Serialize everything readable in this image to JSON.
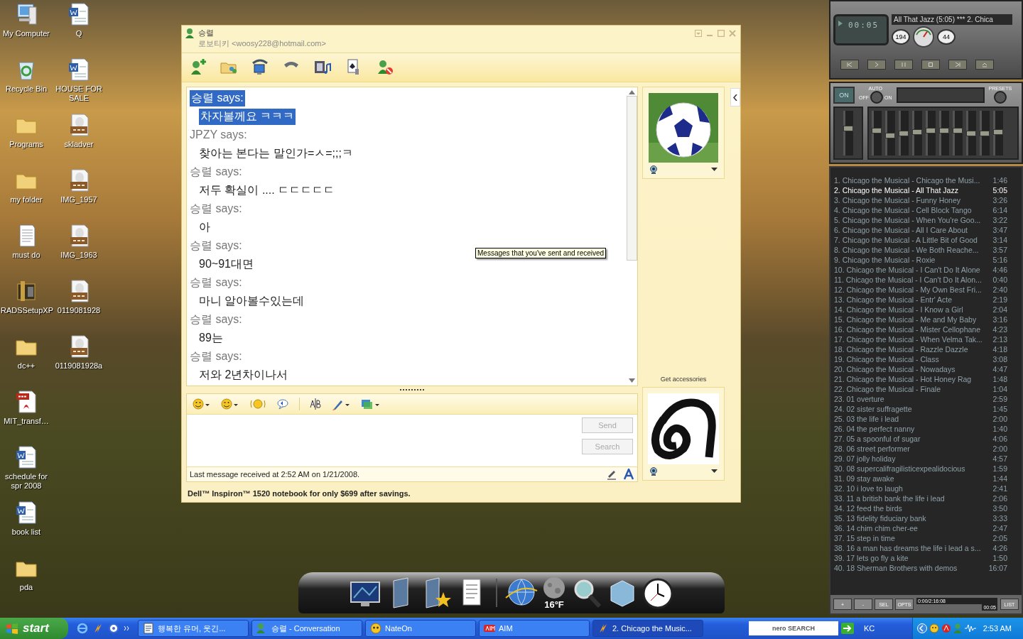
{
  "desktop_icons": [
    {
      "label": "My Computer",
      "kind": "computer"
    },
    {
      "label": "Recycle Bin",
      "kind": "recycle"
    },
    {
      "label": "Programs",
      "kind": "folder"
    },
    {
      "label": "my folder",
      "kind": "folder"
    },
    {
      "label": "must do",
      "kind": "text"
    },
    {
      "label": "RADSSetupXP",
      "kind": "installer"
    },
    {
      "label": "dc++",
      "kind": "folder"
    },
    {
      "label": "MIT_transf…",
      "kind": "pdf"
    },
    {
      "label": "schedule for spr 2008",
      "kind": "word"
    },
    {
      "label": "book list",
      "kind": "word"
    },
    {
      "label": "pda",
      "kind": "folder"
    },
    {
      "label": "Q",
      "kind": "word"
    },
    {
      "label": "HOUSE FOR SALE",
      "kind": "word"
    },
    {
      "label": "skladver",
      "kind": "jpg"
    },
    {
      "label": "IMG_1957",
      "kind": "jpg"
    },
    {
      "label": "IMG_1963",
      "kind": "jpg"
    },
    {
      "label": "0119081928",
      "kind": "jpg"
    },
    {
      "label": "0119081928a",
      "kind": "jpg"
    }
  ],
  "messenger": {
    "title": "승렬",
    "subtitle": "로보티키 <woosy228@hotmail.com>",
    "messages": [
      {
        "sender": "승렬 says:",
        "text": "차자볼께요 ㅋㅋㅋ",
        "selected": true
      },
      {
        "sender": "JPZY says:",
        "text": "찾아는 본다는 말인가=ㅅ=;;;ㅋ",
        "selected": false
      },
      {
        "sender": "승렬 says:",
        "text": "저두 확실이 .... ㄷㄷㄷㄷㄷ",
        "selected": false
      },
      {
        "sender": "승렬 says:",
        "text": "아",
        "selected": false
      },
      {
        "sender": "승렬 says:",
        "text": "90~91대면",
        "selected": false
      },
      {
        "sender": "승렬 says:",
        "text": "마니 알아볼수있는데",
        "selected": false
      },
      {
        "sender": "승렬 says:",
        "text": "89는",
        "selected": false
      },
      {
        "sender": "승렬 says:",
        "text": "저와 2년차이나서",
        "selected": false
      }
    ],
    "tooltip": "Messages that you've sent and received",
    "accessories_link": "Get accessories",
    "buttons": [
      {
        "label": "Send",
        "disabled": true
      },
      {
        "label": "Search",
        "disabled": true
      }
    ],
    "status": "Last message received at 2:52 AM on 1/21/2008.",
    "ad": "Dell™ Inspiron™ 1520 notebook for only $699 after savings."
  },
  "winamp": {
    "time": "00:05",
    "marquee": "All That Jazz (5:05) *** 2. Chica",
    "kbps": "194",
    "khz": "44",
    "preamp": {
      "level": 0.6
    },
    "bands": [
      {
        "level": 0.55
      },
      {
        "level": 0.45
      },
      {
        "level": 0.5
      },
      {
        "level": 0.52
      },
      {
        "level": 0.55
      },
      {
        "level": 0.55
      },
      {
        "level": 0.55
      },
      {
        "level": 0.5
      },
      {
        "level": 0.5
      },
      {
        "level": 0.52
      }
    ],
    "eq_labels": {
      "power": "ON",
      "auto": "AUTO",
      "off": "OFF",
      "on": "ON",
      "presets": "PRESETS"
    },
    "tracks": [
      {
        "title": "1. Chicago the Musical - Chicago the Musi...",
        "duration": "1:46",
        "selected": false
      },
      {
        "title": "2. Chicago the Musical - All That Jazz",
        "duration": "5:05",
        "selected": true
      },
      {
        "title": "3. Chicago the Musical - Funny Honey",
        "duration": "3:26",
        "selected": false
      },
      {
        "title": "4. Chicago the Musical - Cell Block Tango",
        "duration": "6:14",
        "selected": false
      },
      {
        "title": "5. Chicago the Musical - When You're Goo...",
        "duration": "3:22",
        "selected": false
      },
      {
        "title": "6. Chicago the Musical - All I Care About",
        "duration": "3:47",
        "selected": false
      },
      {
        "title": "7. Chicago the Musical - A Little Bit of Good",
        "duration": "3:14",
        "selected": false
      },
      {
        "title": "8. Chicago the Musical - We Both Reache...",
        "duration": "3:57",
        "selected": false
      },
      {
        "title": "9. Chicago the Musical - Roxie",
        "duration": "5:16",
        "selected": false
      },
      {
        "title": "10. Chicago the Musical - I Can't Do It Alone",
        "duration": "4:46",
        "selected": false
      },
      {
        "title": "11. Chicago the Musical - I Can't Do It Alon...",
        "duration": "0:40",
        "selected": false
      },
      {
        "title": "12. Chicago the Musical - My Own Best Fri...",
        "duration": "2:40",
        "selected": false
      },
      {
        "title": "13. Chicago the Musical - Entr' Acte",
        "duration": "2:19",
        "selected": false
      },
      {
        "title": "14. Chicago the Musical - I Know a Girl",
        "duration": "2:04",
        "selected": false
      },
      {
        "title": "15. Chicago the Musical - Me and My Baby",
        "duration": "3:16",
        "selected": false
      },
      {
        "title": "16. Chicago the Musical - Mister Cellophane",
        "duration": "4:23",
        "selected": false
      },
      {
        "title": "17. Chicago the Musical - When Velma Tak...",
        "duration": "2:13",
        "selected": false
      },
      {
        "title": "18. Chicago the Musical - Razzle Dazzle",
        "duration": "4:18",
        "selected": false
      },
      {
        "title": "19. Chicago the Musical - Class",
        "duration": "3:08",
        "selected": false
      },
      {
        "title": "20. Chicago the Musical - Nowadays",
        "duration": "4:47",
        "selected": false
      },
      {
        "title": "21. Chicago the Musical - Hot Honey Rag",
        "duration": "1:48",
        "selected": false
      },
      {
        "title": "22. Chicago the Musical - Finale",
        "duration": "1:04",
        "selected": false
      },
      {
        "title": "23. 01 overture",
        "duration": "2:59",
        "selected": false
      },
      {
        "title": "24. 02 sister suffragette",
        "duration": "1:45",
        "selected": false
      },
      {
        "title": "25. 03 the life i lead",
        "duration": "2:00",
        "selected": false
      },
      {
        "title": "26. 04 the perfect nanny",
        "duration": "1:40",
        "selected": false
      },
      {
        "title": "27. 05 a spoonful of sugar",
        "duration": "4:06",
        "selected": false
      },
      {
        "title": "28. 06 street performer",
        "duration": "2:00",
        "selected": false
      },
      {
        "title": "29. 07 jolly holiday",
        "duration": "4:57",
        "selected": false
      },
      {
        "title": "30. 08 supercalifragilisticexpealidocious",
        "duration": "1:59",
        "selected": false
      },
      {
        "title": "31. 09 stay awake",
        "duration": "1:44",
        "selected": false
      },
      {
        "title": "32. 10 i love to laugh",
        "duration": "2:41",
        "selected": false
      },
      {
        "title": "33. 11 a british bank the life i lead",
        "duration": "2:06",
        "selected": false
      },
      {
        "title": "34. 12 feed the birds",
        "duration": "3:50",
        "selected": false
      },
      {
        "title": "35. 13 fidelity fiduciary bank",
        "duration": "3:33",
        "selected": false
      },
      {
        "title": "36. 14 chim chim cher-ee",
        "duration": "2:47",
        "selected": false
      },
      {
        "title": "37. 15 step in time",
        "duration": "2:05",
        "selected": false
      },
      {
        "title": "38. 16 a man has dreams the life i lead a s...",
        "duration": "4:26",
        "selected": false
      },
      {
        "title": "39. 17 lets go fly a kite",
        "duration": "1:50",
        "selected": false
      },
      {
        "title": "40. 18 Sherman Brothers with demos",
        "duration": "16:07",
        "selected": false
      }
    ],
    "playlist_buttons": [
      "+",
      "-",
      "SEL",
      "OPTS",
      "LIST"
    ],
    "playlist_time": "0:00/2:16:08",
    "playlist_counter": "00:05"
  },
  "dock": {
    "temperature": "16°F"
  },
  "taskbar": {
    "start": "start",
    "tasks": [
      {
        "label": "행복한 유머, 웃긴...",
        "selected": false
      },
      {
        "label": "승렬 - Conversation",
        "selected": false
      },
      {
        "label": "NateOn",
        "selected": false
      },
      {
        "label": "AIM",
        "selected": false
      },
      {
        "label": "2. Chicago the Music...",
        "selected": true
      }
    ],
    "search_logo": "nero SEARCH",
    "language": "KC",
    "clock": "2:53 AM"
  }
}
